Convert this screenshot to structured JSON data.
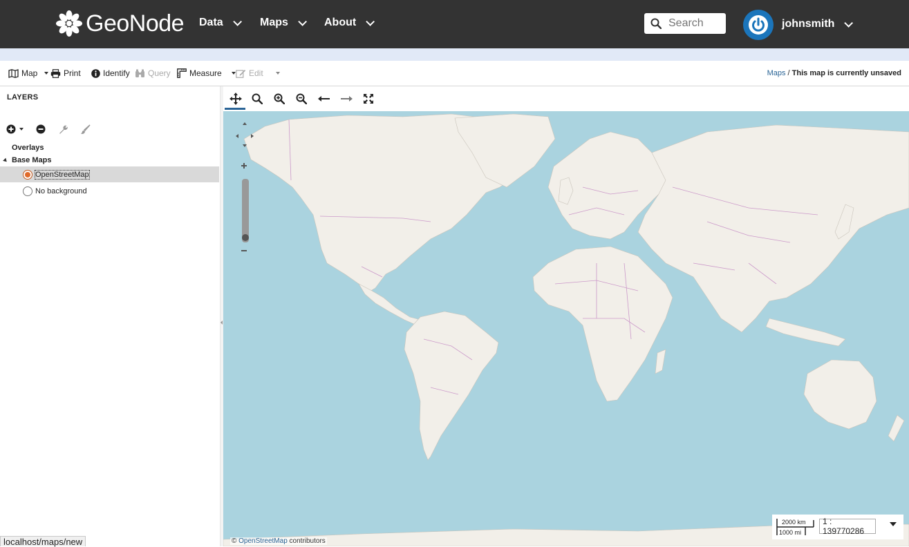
{
  "navbar": {
    "logo_text": "GeoNode",
    "menus": [
      {
        "label": "Data"
      },
      {
        "label": "Maps"
      },
      {
        "label": "About"
      }
    ],
    "search_placeholder": "Search",
    "username": "johnsmith",
    "icons": {
      "logo": "geonode-flower-icon",
      "search": "search-icon",
      "avatar": "power-icon",
      "dropdown": "chevron-down-icon"
    }
  },
  "toolbar": {
    "map_label": "Map",
    "print_label": "Print",
    "identify_label": "Identify",
    "query_label": "Query",
    "measure_label": "Measure",
    "edit_label": "Edit"
  },
  "breadcrumb": {
    "maps_link": "Maps",
    "separator": "/",
    "current": "This map is currently unsaved"
  },
  "layers": {
    "title": "LAYERS",
    "groups": {
      "overlays": "Overlays",
      "base_maps": "Base Maps"
    },
    "base_layers": [
      {
        "label": "OpenStreetMap",
        "selected": true
      },
      {
        "label": "No background",
        "selected": false
      }
    ]
  },
  "map": {
    "attribution_prefix": "©",
    "attribution_link": "OpenStreetMap",
    "attribution_suffix": "contributors",
    "scale_km": "2000 km",
    "scale_mi": "1000 mi",
    "scale_value": "1 : 139770286",
    "colors": {
      "water": "#aad3df",
      "land": "#f2efe9",
      "border": "#c78fc6"
    }
  },
  "status_url": "localhost/maps/new"
}
